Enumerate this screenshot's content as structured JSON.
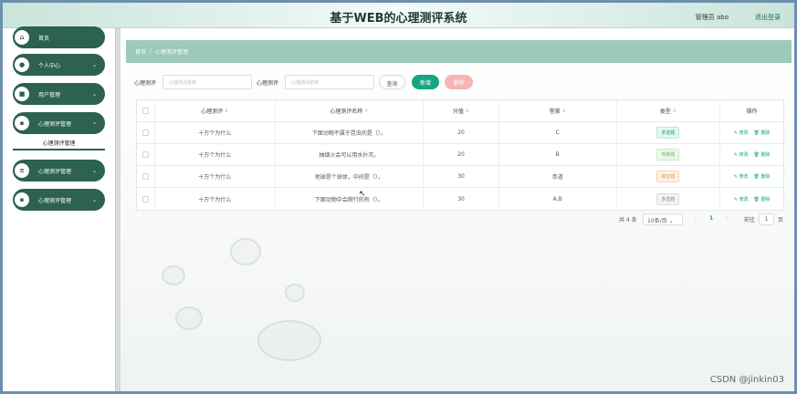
{
  "header": {
    "title": "基于WEB的心理测评系统",
    "admin": "管理员 abo",
    "logout": "退出登录"
  },
  "sidebar": {
    "items": [
      {
        "label": "首页",
        "icon": "home-icon",
        "glyph": "⌂"
      },
      {
        "label": "个人中心",
        "icon": "user-icon",
        "glyph": "●"
      },
      {
        "label": "用户管理",
        "icon": "lock-icon",
        "glyph": "■"
      },
      {
        "label": "心理测评管理",
        "icon": "grid-icon",
        "glyph": "▪"
      },
      {
        "label": "心理测评管理",
        "icon": "list-icon",
        "glyph": "≡"
      },
      {
        "label": "心理测评管理",
        "icon": "grid-icon",
        "glyph": "▪"
      }
    ],
    "submenu": "心理测评管理",
    "arrow": "⌄"
  },
  "breadcrumb": {
    "home": "首页",
    "sep": "/",
    "current": "心理测评管理"
  },
  "search": {
    "label1": "心理测评",
    "placeholder1": "心理测评名称",
    "label2": "心理测评",
    "placeholder2": "心理测评名称",
    "query": "查询",
    "add": "新增",
    "delete": "删除"
  },
  "table": {
    "headers": [
      "心理测评",
      "心理测评名称",
      "分值",
      "答案",
      "类型",
      "操作"
    ],
    "sort_glyph": "⇕",
    "rows": [
      {
        "a": "十万个为什么",
        "b": "下面动物不属于昆虫的是（）。",
        "c": "20",
        "d": "C",
        "type": "单选题",
        "type_color": "#1aa37f",
        "type_bg": "#e6f6f0"
      },
      {
        "a": "十万个为什么",
        "b": "抽烟火会可以用水扑灭。",
        "c": "20",
        "d": "B",
        "type": "判断题",
        "type_color": "#5bbf55",
        "type_bg": "#eef8ec"
      },
      {
        "a": "十万个为什么",
        "b": "地球是个球体，中间是（）。",
        "c": "30",
        "d": "赤道",
        "type": "填空题",
        "type_color": "#e59a4c",
        "type_bg": "#fdf1e5"
      },
      {
        "a": "十万个为什么",
        "b": "下面动物中会爬行的有（）。",
        "c": "30",
        "d": "A,B",
        "type": "多选题",
        "type_color": "#888888",
        "type_bg": "#f3f3f3"
      }
    ],
    "edit": "✎ 修改",
    "remove": "🗑 删除"
  },
  "pagination": {
    "total": "共 4 条",
    "page_size": "10条/页",
    "prev": "‹",
    "current": "1",
    "next": "›",
    "goto": "前往",
    "goto_value": "1",
    "page_unit": "页"
  },
  "watermark": "CSDN @jinkin03"
}
